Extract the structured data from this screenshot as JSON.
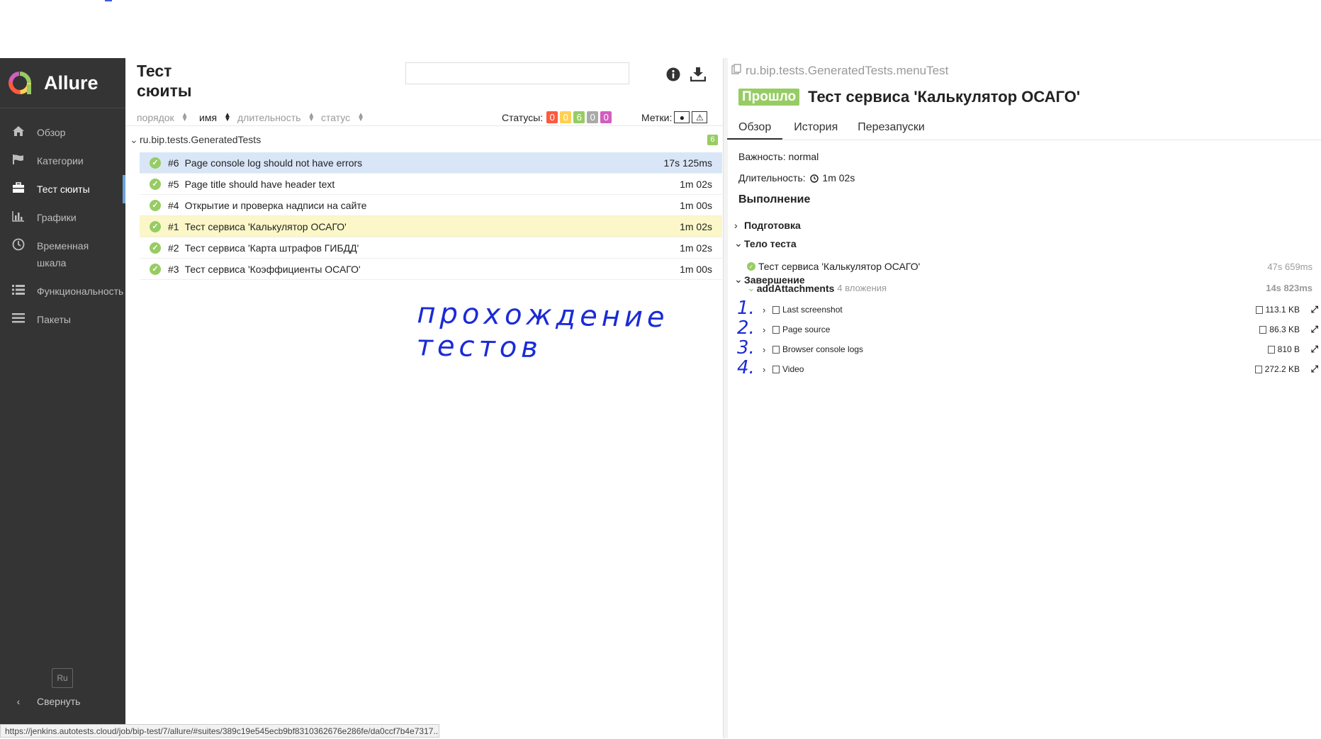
{
  "app": {
    "name": "Allure"
  },
  "sidebar": {
    "items": [
      {
        "label": "Обзор",
        "icon": "home-icon"
      },
      {
        "label": "Категории",
        "icon": "flag-icon"
      },
      {
        "label": "Тест сюиты",
        "icon": "briefcase-icon",
        "active": true
      },
      {
        "label": "Графики",
        "icon": "bar-chart-icon"
      },
      {
        "label": "Временная шкала",
        "icon": "clock-icon"
      },
      {
        "label": "Функциональность",
        "icon": "list-icon"
      },
      {
        "label": "Пакеты",
        "icon": "menu-icon"
      }
    ],
    "lang": "Ru",
    "collapse_label": "Свернуть"
  },
  "suites": {
    "title_line1": "Тест",
    "title_line2": "сюиты",
    "search_placeholder": "",
    "sort": {
      "order": "порядок",
      "name": "имя",
      "duration": "длительность",
      "status": "статус"
    },
    "statuses_label": "Статусы:",
    "status_counts": [
      {
        "value": "0",
        "color": "#fd5a3e"
      },
      {
        "value": "0",
        "color": "#ffd050"
      },
      {
        "value": "6",
        "color": "#97cc64"
      },
      {
        "value": "0",
        "color": "#aaaaaa"
      },
      {
        "value": "0",
        "color": "#d35ebe"
      }
    ],
    "marks_label": "Метки:",
    "group": {
      "name": "ru.bip.tests.GeneratedTests",
      "count": "6"
    },
    "tests": [
      {
        "num": "#6",
        "name": "Page console log should not have errors",
        "duration": "17s 125ms",
        "state": "selected"
      },
      {
        "num": "#5",
        "name": "Page title should have header text",
        "duration": "1m 02s",
        "state": ""
      },
      {
        "num": "#4",
        "name": "Открытие и проверка надписи на сайте",
        "duration": "1m 00s",
        "state": ""
      },
      {
        "num": "#1",
        "name": "Тест сервиса 'Калькулятор ОСАГО'",
        "duration": "1m 02s",
        "state": "highlight"
      },
      {
        "num": "#2",
        "name": "Тест сервиса 'Карта штрафов ГИБДД'",
        "duration": "1m 02s",
        "state": ""
      },
      {
        "num": "#3",
        "name": "Тест сервиса 'Коэффициенты ОСАГО'",
        "duration": "1m 00s",
        "state": ""
      }
    ],
    "handwriting": "прохождение тестов"
  },
  "detail": {
    "breadcrumb": "ru.bip.tests.GeneratedTests.menuTest",
    "status": "Прошло",
    "title": "Тест сервиса 'Калькулятор ОСАГО'",
    "tabs": [
      "Обзор",
      "История",
      "Перезапуски"
    ],
    "severity": "Важность: normal",
    "duration_label": "Длительность:",
    "duration": "1m 02s",
    "execution_heading": "Выполнение",
    "setup": "Подготовка",
    "body": "Тело теста",
    "step_name": "Тест сервиса 'Калькулятор ОСАГО'",
    "step_duration": "47s 659ms",
    "teardown": "Завершение",
    "sub_step": "addAttachments",
    "sub_step_count": "4 вложения",
    "sub_step_duration": "14s 823ms",
    "attachments": [
      {
        "hand": "1.",
        "name": "Last screenshot",
        "size": "113.1 KB"
      },
      {
        "hand": "2.",
        "name": "Page source",
        "size": "86.3 KB"
      },
      {
        "hand": "3.",
        "name": "Browser console logs",
        "size": "810 B"
      },
      {
        "hand": "4.",
        "name": "Video",
        "size": "272.2 KB"
      }
    ]
  },
  "statusbar": {
    "url": "https://jenkins.autotests.cloud/job/bip-test/7/allure/#suites/389c19e545ecb9bf8310362676e286fe/da0ccf7b4e7317.."
  }
}
